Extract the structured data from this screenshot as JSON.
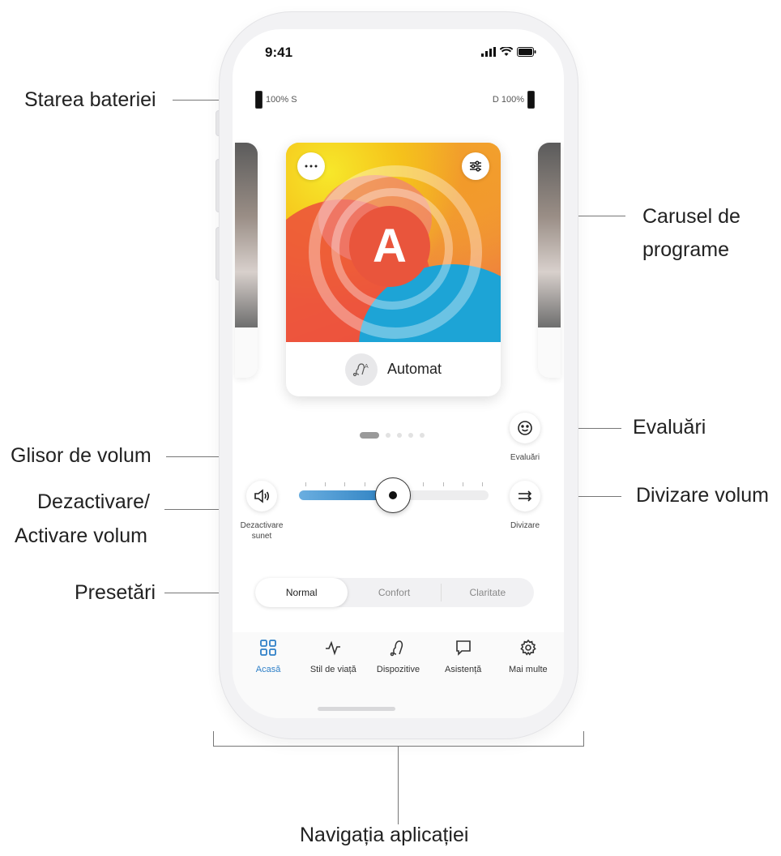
{
  "annotations": {
    "battery_status": "Starea bateriei",
    "program_carousel_line1": "Carusel de",
    "program_carousel_line2": "programe",
    "ratings": "Evaluări",
    "volume_slider": "Glisor de volum",
    "mute_line1": "Dezactivare/",
    "mute_line2": "Activare volum",
    "split_volume": "Divizare volum",
    "presets": "Presetări",
    "app_navigation": "Navigația aplicației"
  },
  "status_bar": {
    "time": "9:41"
  },
  "battery": {
    "left_label": "100% S",
    "right_label": "D 100%"
  },
  "program": {
    "badge_letter": "A",
    "name": "Automat",
    "menu_icon": "ellipsis-icon",
    "settings_icon": "sliders-icon"
  },
  "carousel": {
    "pages": 5,
    "active_page": 1
  },
  "ratings_button": {
    "label": "Evaluări",
    "icon": "smiley-icon"
  },
  "mute_button": {
    "label_line1": "Dezactivare",
    "label_line2": "sunet",
    "icon": "speaker-icon"
  },
  "split_button": {
    "label": "Divizare",
    "icon": "split-arrows-icon"
  },
  "volume": {
    "level": 0.49,
    "ticks": 10
  },
  "presets": {
    "items": [
      "Normal",
      "Confort",
      "Claritate"
    ],
    "selected": "Normal"
  },
  "nav": {
    "items": [
      {
        "label": "Acasă",
        "icon": "grid-icon",
        "active": true
      },
      {
        "label": "Stil de viață",
        "icon": "activity-icon",
        "active": false
      },
      {
        "label": "Dispozitive",
        "icon": "hearing-aid-icon",
        "active": false
      },
      {
        "label": "Asistență",
        "icon": "chat-icon",
        "active": false
      },
      {
        "label": "Mai multe",
        "icon": "gear-icon",
        "active": false
      }
    ]
  },
  "colors": {
    "accent": "#2f80c8",
    "slider_fill": "#2b7fc0",
    "leader": "#777777"
  }
}
